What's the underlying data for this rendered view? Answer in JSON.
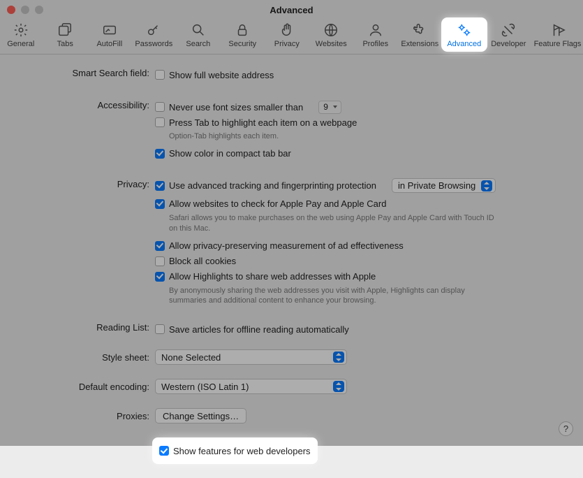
{
  "window": {
    "title": "Advanced"
  },
  "tabs": {
    "general": "General",
    "tabs": "Tabs",
    "autofill": "AutoFill",
    "passwords": "Passwords",
    "search": "Search",
    "security": "Security",
    "privacy": "Privacy",
    "websites": "Websites",
    "profiles": "Profiles",
    "extensions": "Extensions",
    "advanced": "Advanced",
    "developer": "Developer",
    "featureflags": "Feature Flags"
  },
  "sections": {
    "smartSearch": {
      "label": "Smart Search field:",
      "showFull": "Show full website address"
    },
    "accessibility": {
      "label": "Accessibility:",
      "neverSmaller": "Never use font sizes smaller than",
      "fontSize": "9",
      "pressTab": "Press Tab to highlight each item on a webpage",
      "pressTabHint": "Option-Tab highlights each item.",
      "compactColor": "Show color in compact tab bar"
    },
    "privacy": {
      "label": "Privacy:",
      "tracking": "Use advanced tracking and fingerprinting protection",
      "trackingScope": "in Private Browsing",
      "applePay": "Allow websites to check for Apple Pay and Apple Card",
      "applePayHint": "Safari allows you to make purchases on the web using Apple Pay and Apple Card with Touch ID on this Mac.",
      "adMeasure": "Allow privacy-preserving measurement of ad effectiveness",
      "blockCookies": "Block all cookies",
      "highlights": "Allow Highlights to share web addresses with Apple",
      "highlightsHint": "By anonymously sharing the web addresses you visit with Apple, Highlights can display summaries and additional content to enhance your browsing."
    },
    "readingList": {
      "label": "Reading List:",
      "offline": "Save articles for offline reading automatically"
    },
    "styleSheet": {
      "label": "Style sheet:",
      "value": "None Selected"
    },
    "encoding": {
      "label": "Default encoding:",
      "value": "Western (ISO Latin 1)"
    },
    "proxies": {
      "label": "Proxies:",
      "button": "Change Settings…"
    },
    "devFeatures": "Show features for web developers"
  },
  "help": "?"
}
